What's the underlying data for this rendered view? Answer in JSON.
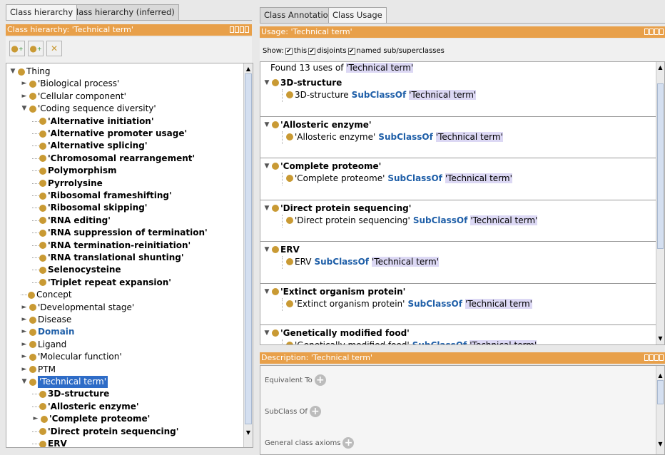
{
  "left": {
    "tabs": [
      "Class hierarchy",
      "Class hierarchy (inferred)"
    ],
    "header_title": "Class hierarchy: 'Technical term'",
    "toolbar_icons": [
      "add-subclass-icon",
      "add-sibling-icon",
      "delete-class-icon"
    ],
    "tree": [
      {
        "label": "Thing",
        "level": 0,
        "toggle": "expanded",
        "style": "normal"
      },
      {
        "label": "'Biological process'",
        "level": 1,
        "toggle": "collapsed",
        "style": "normal"
      },
      {
        "label": "'Cellular component'",
        "level": 1,
        "toggle": "collapsed",
        "style": "normal"
      },
      {
        "label": "'Coding sequence diversity'",
        "level": 1,
        "toggle": "expanded",
        "style": "normal"
      },
      {
        "label": "'Alternative initiation'",
        "level": 2,
        "toggle": "none",
        "style": "bold"
      },
      {
        "label": "'Alternative promoter usage'",
        "level": 2,
        "toggle": "none",
        "style": "bold"
      },
      {
        "label": "'Alternative splicing'",
        "level": 2,
        "toggle": "none",
        "style": "bold"
      },
      {
        "label": "'Chromosomal rearrangement'",
        "level": 2,
        "toggle": "none",
        "style": "bold"
      },
      {
        "label": "Polymorphism",
        "level": 2,
        "toggle": "none",
        "style": "bold"
      },
      {
        "label": "Pyrrolysine",
        "level": 2,
        "toggle": "none",
        "style": "bold"
      },
      {
        "label": "'Ribosomal frameshifting'",
        "level": 2,
        "toggle": "none",
        "style": "bold"
      },
      {
        "label": "'Ribosomal skipping'",
        "level": 2,
        "toggle": "none",
        "style": "bold"
      },
      {
        "label": "'RNA editing'",
        "level": 2,
        "toggle": "none",
        "style": "bold"
      },
      {
        "label": "'RNA suppression of termination'",
        "level": 2,
        "toggle": "none",
        "style": "bold"
      },
      {
        "label": "'RNA termination-reinitiation'",
        "level": 2,
        "toggle": "none",
        "style": "bold"
      },
      {
        "label": "'RNA translational shunting'",
        "level": 2,
        "toggle": "none",
        "style": "bold"
      },
      {
        "label": "Selenocysteine",
        "level": 2,
        "toggle": "none",
        "style": "bold"
      },
      {
        "label": "'Triplet repeat expansion'",
        "level": 2,
        "toggle": "none",
        "style": "bold"
      },
      {
        "label": "Concept",
        "level": 1,
        "toggle": "none",
        "style": "normal"
      },
      {
        "label": "'Developmental stage'",
        "level": 1,
        "toggle": "collapsed",
        "style": "normal"
      },
      {
        "label": "Disease",
        "level": 1,
        "toggle": "collapsed",
        "style": "normal"
      },
      {
        "label": "Domain",
        "level": 1,
        "toggle": "collapsed",
        "style": "blue"
      },
      {
        "label": "Ligand",
        "level": 1,
        "toggle": "collapsed",
        "style": "normal"
      },
      {
        "label": "'Molecular function'",
        "level": 1,
        "toggle": "collapsed",
        "style": "normal"
      },
      {
        "label": "PTM",
        "level": 1,
        "toggle": "collapsed",
        "style": "normal"
      },
      {
        "label": "'Technical term'",
        "level": 1,
        "toggle": "expanded",
        "style": "selected"
      },
      {
        "label": "3D-structure",
        "level": 2,
        "toggle": "none",
        "style": "bold"
      },
      {
        "label": "'Allosteric enzyme'",
        "level": 2,
        "toggle": "none",
        "style": "bold"
      },
      {
        "label": "'Complete proteome'",
        "level": 2,
        "toggle": "collapsed",
        "style": "bold"
      },
      {
        "label": "'Direct protein sequencing'",
        "level": 2,
        "toggle": "none",
        "style": "bold"
      },
      {
        "label": "ERV",
        "level": 2,
        "toggle": "none",
        "style": "bold"
      }
    ]
  },
  "right": {
    "tabs": [
      "Class Annotations",
      "Class Usage"
    ],
    "usage_header": "Usage: 'Technical term'",
    "show_label": "Show:",
    "show_options": [
      {
        "label": "this",
        "checked": true
      },
      {
        "label": "disjoints",
        "checked": true
      },
      {
        "label": "named sub/superclasses",
        "checked": true
      }
    ],
    "found_prefix": "Found 13 uses of ",
    "found_term": "'Technical term'",
    "keyword": "SubClassOf",
    "target": "'Technical term'",
    "usages": [
      {
        "name": "3D-structure"
      },
      {
        "name": "'Allosteric enzyme'"
      },
      {
        "name": "'Complete proteome'"
      },
      {
        "name": "'Direct protein sequencing'"
      },
      {
        "name": "ERV"
      },
      {
        "name": "'Extinct organism protein'"
      },
      {
        "name": "'Genetically modified food'"
      }
    ],
    "description_header": "Description: 'Technical term'",
    "description_sections": [
      "Equivalent To",
      "SubClass Of",
      "General class axioms"
    ]
  },
  "colors": {
    "header": "#e8a04a",
    "class_dot": "#c99a34",
    "selection": "#2e6cc7",
    "keyword": "#1f5fa8",
    "term_highlight": "#dcd8f4"
  }
}
